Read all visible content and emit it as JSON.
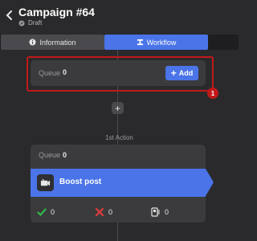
{
  "header": {
    "title": "Campaign #64",
    "status": "Draft"
  },
  "tabs": [
    {
      "label": "Information"
    },
    {
      "label": "Workflow"
    }
  ],
  "queue": {
    "label": "Queue",
    "count": "0",
    "add_label": "Add",
    "badge": "1"
  },
  "action": {
    "section_label": "1st Action",
    "queue_label": "Queue",
    "queue_count": "0",
    "title": "Boost post",
    "stats": {
      "success": "0",
      "failed": "0",
      "skipped": "0"
    }
  },
  "colors": {
    "accent": "#4a74e8",
    "highlight": "#c0191a",
    "success": "#2fb84a",
    "failed": "#e03b3b"
  }
}
